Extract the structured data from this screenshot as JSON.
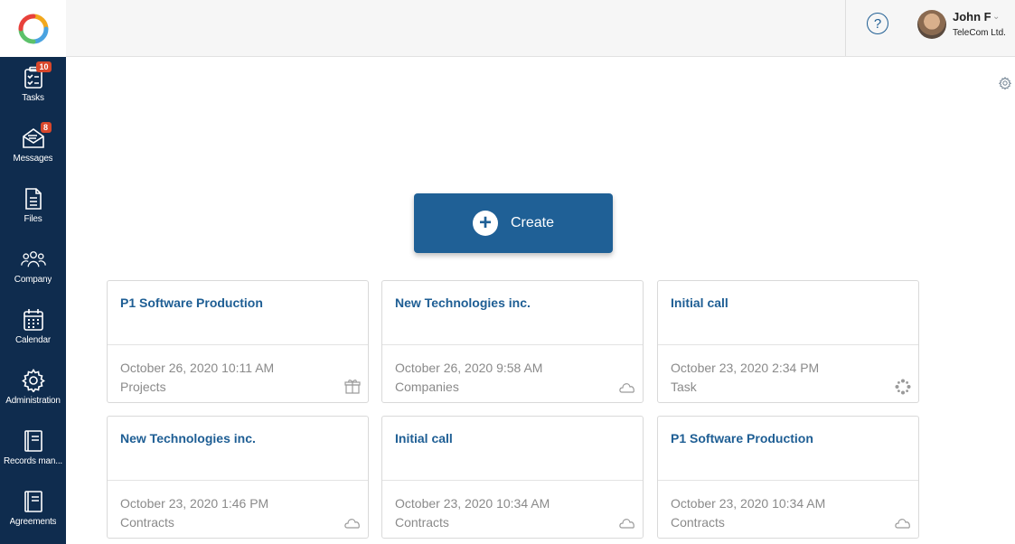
{
  "sidebar": {
    "items": [
      {
        "label": "Tasks",
        "icon": "tasks-icon",
        "badge": "10"
      },
      {
        "label": "Messages",
        "icon": "messages-icon",
        "badge": "8"
      },
      {
        "label": "Files",
        "icon": "files-icon",
        "badge": ""
      },
      {
        "label": "Company",
        "icon": "company-icon",
        "badge": ""
      },
      {
        "label": "Calendar",
        "icon": "calendar-icon",
        "badge": ""
      },
      {
        "label": "Administration",
        "icon": "gear-icon",
        "badge": ""
      },
      {
        "label": "Records man...",
        "icon": "book-icon",
        "badge": ""
      },
      {
        "label": "Agreements",
        "icon": "book-icon",
        "badge": ""
      }
    ]
  },
  "header": {
    "help": "?",
    "user_name": "John F",
    "user_org": "TeleCom Ltd."
  },
  "main": {
    "create_label": "Create",
    "cards": [
      {
        "title": "P1 Software Production",
        "date": "October 26, 2020 10:11 AM",
        "type": "Projects",
        "icon": "box-icon"
      },
      {
        "title": "New Technologies inc.",
        "date": "October 26, 2020 9:58 AM",
        "type": "Companies",
        "icon": "cloud-icon"
      },
      {
        "title": "Initial call",
        "date": "October 23, 2020 2:34 PM",
        "type": "Task",
        "icon": "spinner-icon"
      },
      {
        "title": "New Technologies inc.",
        "date": "October 23, 2020 1:46 PM",
        "type": "Contracts",
        "icon": "cloud-icon"
      },
      {
        "title": "Initial call",
        "date": "October 23, 2020 10:34 AM",
        "type": "Contracts",
        "icon": "cloud-icon"
      },
      {
        "title": "P1 Software Production",
        "date": "October 23, 2020 10:34 AM",
        "type": "Contracts",
        "icon": "cloud-icon"
      }
    ]
  },
  "colors": {
    "sidebar_bg": "#0f2c4e",
    "accent": "#1f6096",
    "card_title": "#1e5e94",
    "badge": "#d9472b"
  }
}
